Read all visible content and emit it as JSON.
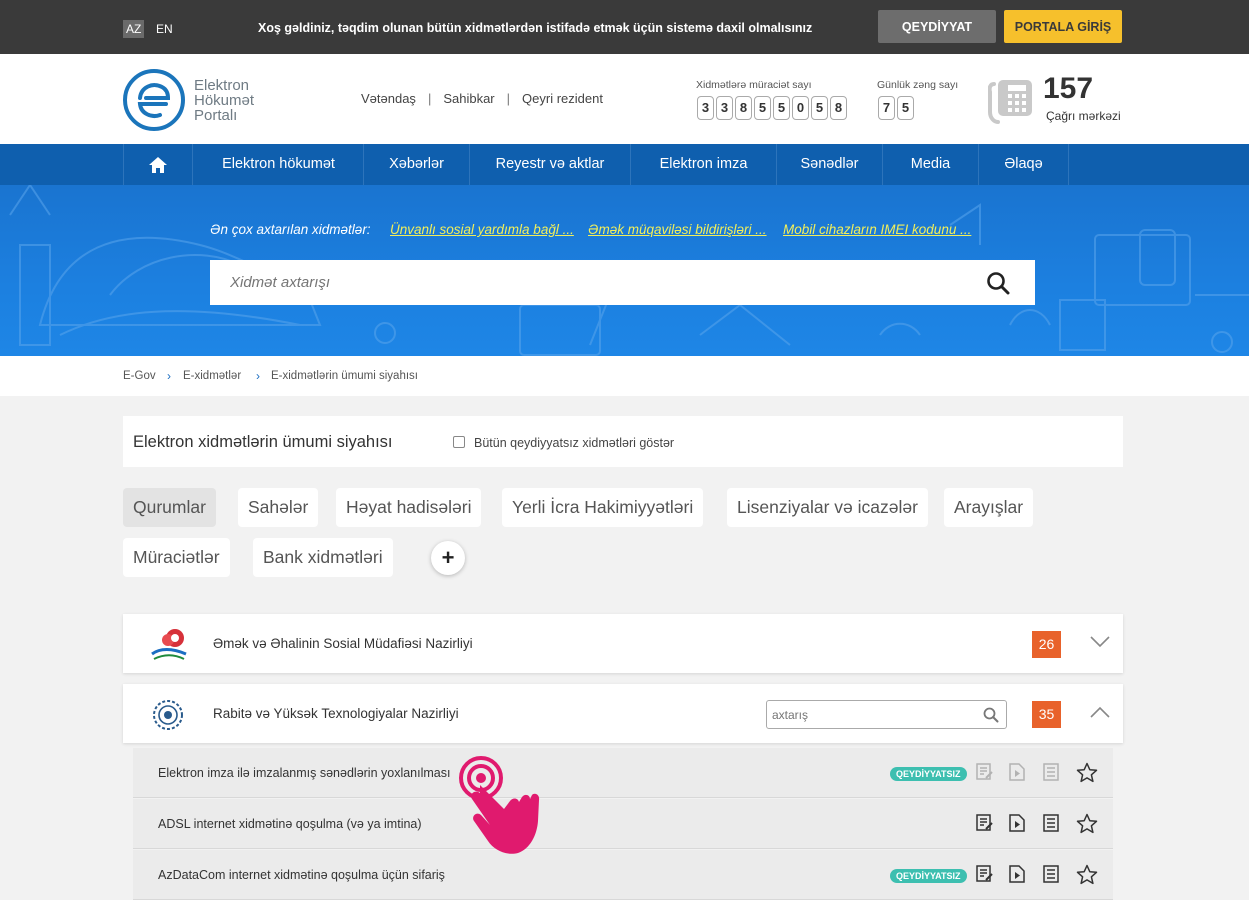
{
  "topbar": {
    "lang_az": "AZ",
    "lang_en": "EN",
    "welcome": "Xoş gəldiniz, təqdim olunan bütün xidmətlərdən istifadə etmək üçün sistemə daxil olmalısınız",
    "register_label": "QEYDİYYAT",
    "login_label": "PORTALA GİRİŞ"
  },
  "header": {
    "logo_line1": "Elektron",
    "logo_line2": "Hökumət",
    "logo_line3": "Portalı",
    "user_types": [
      "Vətəndaş",
      "Sahibkar",
      "Qeyri rezident"
    ],
    "user_sep": "|",
    "applications_label": "Xidmətlərə müraciət sayı",
    "applications_digits": [
      "3",
      "3",
      "8",
      "5",
      "5",
      "0",
      "5",
      "8"
    ],
    "daily_calls_label": "Günlük zəng sayı",
    "daily_calls_digits": [
      "7",
      "5"
    ],
    "call_number": "157",
    "call_label": "Çağrı mərkəzi"
  },
  "nav": {
    "items": [
      "Elektron hökumət",
      "Xəbərlər",
      "Reyestr və aktlar",
      "Elektron imza",
      "Sənədlər",
      "Media",
      "Əlaqə"
    ]
  },
  "hero": {
    "popular_label": "Ən çox axtarılan xidmətlər:",
    "popular_links": [
      "Ünvanlı sosial yardımla bağl ...",
      "Əmək müqaviləsi bildirişləri ...",
      "Mobil cihazların IMEI kodunu ..."
    ],
    "search_placeholder": "Xidmət axtarışı"
  },
  "breadcrumb": {
    "items": [
      "E-Gov",
      "E-xidmətlər",
      "E-xidmətlərin ümumi siyahısı"
    ],
    "sep": "›"
  },
  "panel": {
    "title": "Elektron xidmətlərin ümumi siyahısı",
    "checkbox_label": "Bütün qeydiyyatsız xidmətləri göstər"
  },
  "chips": {
    "items": [
      "Qurumlar",
      "Sahələr",
      "Həyat hadisələri",
      "Yerli İcra Hakimiyyətləri",
      "Lisenziyalar və icazələr",
      "Arayışlar",
      "Müraciətlər",
      "Bank xidmətləri"
    ],
    "plus": "+"
  },
  "agencies": [
    {
      "name": "Əmək və Əhalinin Sosial Müdafiəsi Nazirliyi",
      "count": "26"
    },
    {
      "name": "Rabitə və Yüksək Texnologiyalar Nazirliyi",
      "count": "35",
      "search_placeholder": "axtarış"
    }
  ],
  "services": [
    {
      "name": "Elektron imza ilə imzalanmış sənədlərin yoxlanılması",
      "badge": "QEYDİYYATSIZ"
    },
    {
      "name": "ADSL internet xidmətinə qoşulma (və ya imtina)",
      "badge": ""
    },
    {
      "name": "AzDataCom internet xidmətinə qoşulma üçün sifariş",
      "badge": "QEYDİYYATSIZ"
    }
  ],
  "colors": {
    "topbar": "#3a3a3a",
    "nav": "#0f5fae",
    "hero": "#1c80e0",
    "accent_yellow": "#f6c02c",
    "count_orange": "#e8622b",
    "badge_teal": "#3dbfb0",
    "link_yellow": "#f2ef5a",
    "hand_pink": "#e01a6e"
  },
  "icons": [
    "home-icon",
    "search-icon",
    "phone-icon",
    "chevron-down-icon",
    "chevron-up-icon",
    "document-edit-icon",
    "video-icon",
    "list-icon",
    "star-icon",
    "hand-pointer-icon"
  ]
}
